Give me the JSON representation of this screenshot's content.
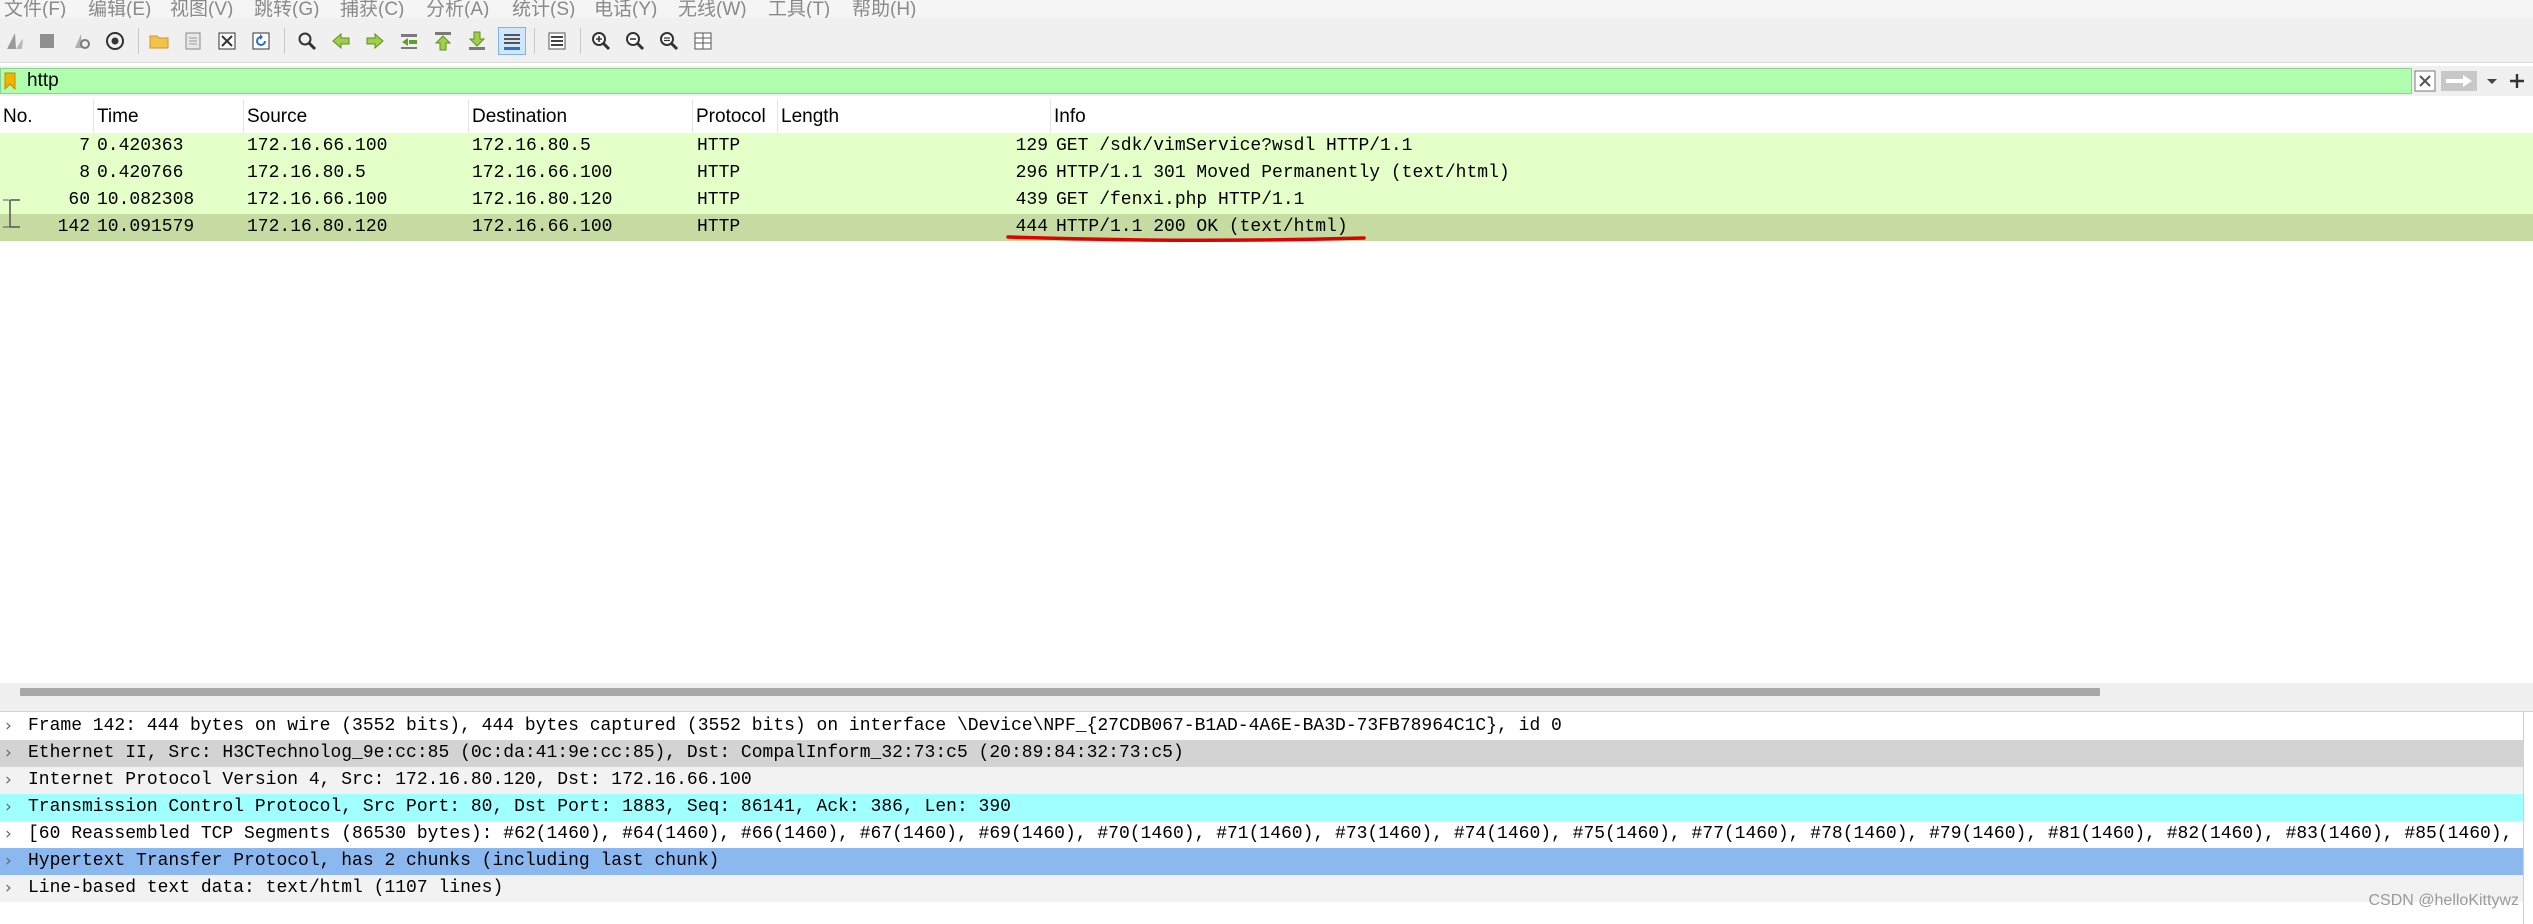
{
  "menu": [
    "文件(F)",
    "编辑(E)",
    "视图(V)",
    "跳转(G)",
    "捕获(C)",
    "分析(A)",
    "统计(S)",
    "电话(Y)",
    "无线(W)",
    "工具(T)",
    "帮助(H)"
  ],
  "toolbar_icons": [
    "shark-fin-start-icon",
    "stop-icon",
    "restart-icon",
    "capture-options-icon",
    "open-folder-icon",
    "file-icon",
    "close-file-icon",
    "reload-icon",
    "search-icon",
    "go-back-icon",
    "go-forward-icon",
    "go-to-packet-icon",
    "go-first-icon",
    "go-last-icon",
    "autoscroll-icon",
    "colorize-icon",
    "zoom-in-icon",
    "zoom-out-icon",
    "zoom-normal-icon",
    "resize-columns-icon"
  ],
  "filter": {
    "value": "http"
  },
  "columns": [
    "No.",
    "Time",
    "Source",
    "Destination",
    "Protocol",
    "Length",
    "Info"
  ],
  "packets": [
    {
      "no": "7",
      "time": "0.420363",
      "src": "172.16.66.100",
      "dst": "172.16.80.5",
      "proto": "HTTP",
      "len": "129",
      "info": "GET /sdk/vimService?wsdl HTTP/1.1"
    },
    {
      "no": "8",
      "time": "0.420766",
      "src": "172.16.80.5",
      "dst": "172.16.66.100",
      "proto": "HTTP",
      "len": "296",
      "info": "HTTP/1.1 301 Moved Permanently  (text/html)"
    },
    {
      "no": "60",
      "time": "10.082308",
      "src": "172.16.66.100",
      "dst": "172.16.80.120",
      "proto": "HTTP",
      "len": "439",
      "info": "GET /fenxi.php HTTP/1.1"
    },
    {
      "no": "142",
      "time": "10.091579",
      "src": "172.16.80.120",
      "dst": "172.16.66.100",
      "proto": "HTTP",
      "len": "444",
      "info": "HTTP/1.1 200 OK  (text/html)"
    }
  ],
  "details": [
    {
      "text": "Frame 142: 444 bytes on wire (3552 bits), 444 bytes captured (3552 bits) on interface \\Device\\NPF_{27CDB067-B1AD-4A6E-BA3D-73FB78964C1C}, id 0",
      "bg": "#ffffff"
    },
    {
      "text": "Ethernet II, Src: H3CTechnolog_9e:cc:85 (0c:da:41:9e:cc:85), Dst: CompalInform_32:73:c5 (20:89:84:32:73:c5)",
      "bg": "#d3d3d3"
    },
    {
      "text": "Internet Protocol Version 4, Src: 172.16.80.120, Dst: 172.16.66.100",
      "bg": "#f2f2f2"
    },
    {
      "text": "Transmission Control Protocol, Src Port: 80, Dst Port: 1883, Seq: 86141, Ack: 386, Len: 390",
      "bg": "#a0ffff"
    },
    {
      "text": "[60 Reassembled TCP Segments (86530 bytes): #62(1460), #64(1460), #66(1460), #67(1460), #69(1460), #70(1460), #71(1460), #73(1460), #74(1460), #75(1460), #77(1460), #78(1460), #79(1460), #81(1460), #82(1460), #83(1460), #85(1460), #8",
      "bg": "#ffffff"
    },
    {
      "text": "Hypertext Transfer Protocol, has 2 chunks (including last chunk)",
      "bg": "#8cb8f0"
    },
    {
      "text": "Line-based text data: text/html (1107 lines)",
      "bg": "#f2f2f2"
    }
  ],
  "watermark": "CSDN @helloKittywz",
  "colors": {
    "row_green": "#e4ffc7",
    "row_selected": "#c6dba2",
    "filter_ok": "#afffaf",
    "annotation_red": "#e00000"
  }
}
